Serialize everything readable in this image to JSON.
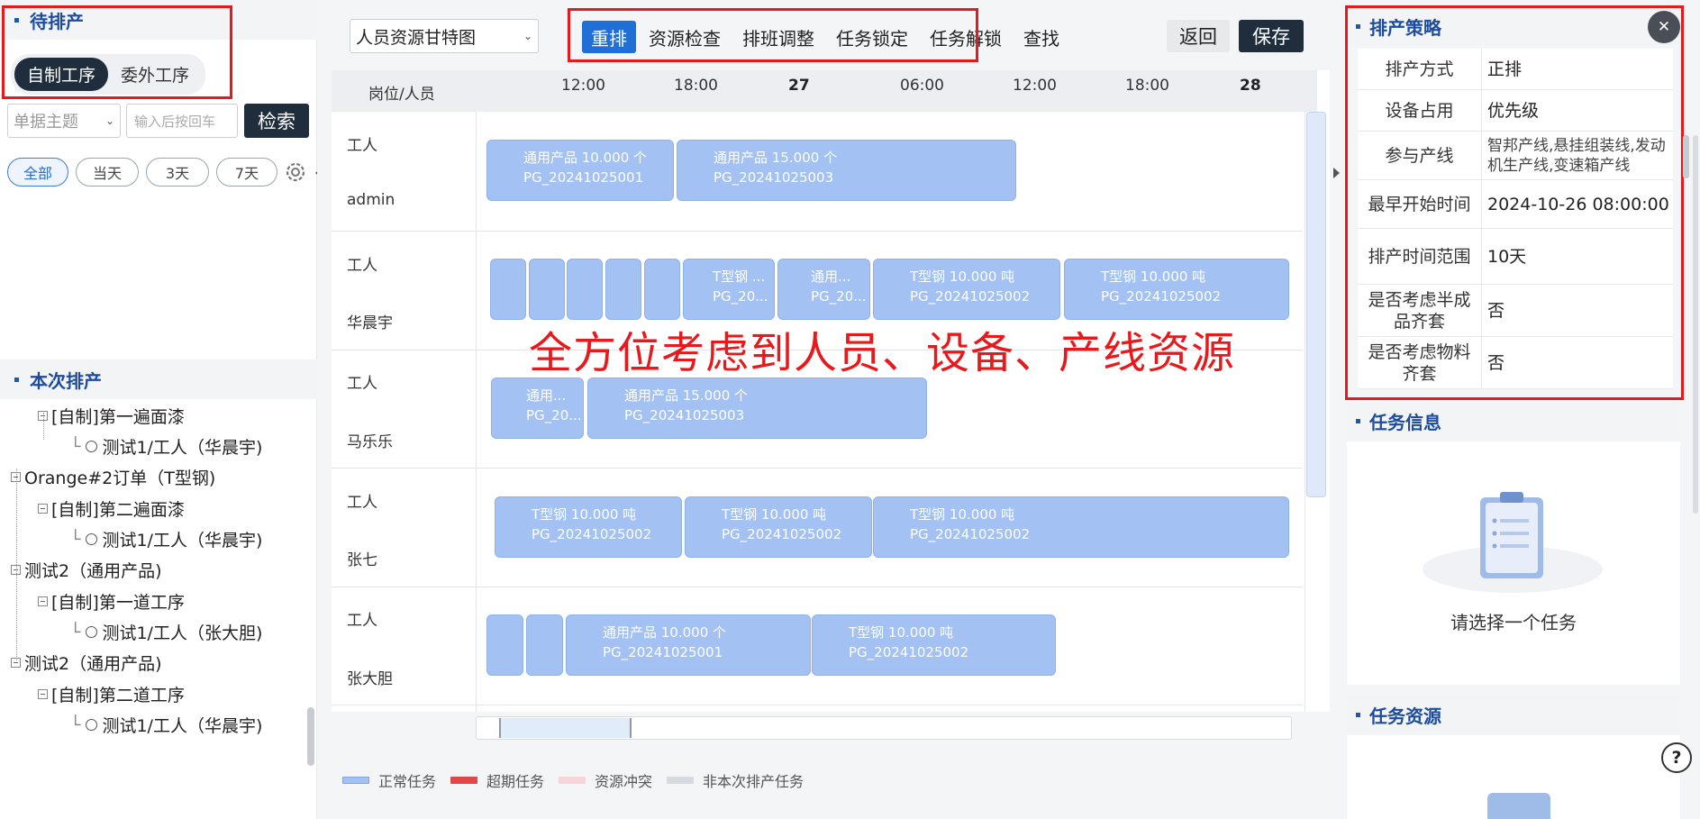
{
  "left": {
    "pending_title": "待排产",
    "tabs": [
      "自制工序",
      "委外工序"
    ],
    "doc_subject_placeholder": "单据主题",
    "search_placeholder": "输入后按回车",
    "search_button": "检索",
    "ranges": [
      "全部",
      "当天",
      "3天",
      "7天"
    ],
    "current_title": "本次排产",
    "tree": [
      "[自制]第一遍面漆",
      "测试1/工人（华晨宇)",
      "Orange#2订单（T型钢)",
      "[自制]第二遍面漆",
      "测试1/工人（华晨宇)",
      "测试2（通用产品)",
      "[自制]第一道工序",
      "测试1/工人（张大胆)",
      "测试2（通用产品)",
      "[自制]第二道工序",
      "测试1/工人（华晨宇)"
    ]
  },
  "center": {
    "view_select": "人员资源甘特图",
    "toolbar": [
      "重排",
      "资源检查",
      "排班调整",
      "任务锁定",
      "任务解锁",
      "查找"
    ],
    "back": "返回",
    "save": "保存",
    "header_label": "岗位/人员",
    "time_ticks": [
      "12:00",
      "18:00",
      "27",
      "06:00",
      "12:00",
      "18:00",
      "28"
    ],
    "rows": [
      {
        "role": "工人",
        "name": "admin"
      },
      {
        "role": "工人",
        "name": "华晨宇"
      },
      {
        "role": "工人",
        "name": "马乐乐"
      },
      {
        "role": "工人",
        "name": "张七"
      },
      {
        "role": "工人",
        "name": "张大胆"
      }
    ],
    "bars": [
      {
        "l1": "通用产品 10.000 个",
        "l2": "PG_20241025001"
      },
      {
        "l1": "通用产品 15.000 个",
        "l2": "PG_20241025003"
      },
      {
        "l1": "T型钢 ...",
        "l2": "PG_20..."
      },
      {
        "l1": "通用...",
        "l2": "PG_20..."
      },
      {
        "l1": "T型钢 10.000 吨",
        "l2": "PG_20241025002"
      },
      {
        "l1": "T型钢 10.000 吨",
        "l2": "PG_20241025002"
      },
      {
        "l1": "通用...",
        "l2": "PG_20..."
      },
      {
        "l1": "通用产品 15.000 个",
        "l2": "PG_20241025003"
      },
      {
        "l1": "T型钢 10.000 吨",
        "l2": "PG_20241025002"
      },
      {
        "l1": "T型钢 10.000 吨",
        "l2": "PG_20241025002"
      },
      {
        "l1": "T型钢 10.000 吨",
        "l2": "PG_20241025002"
      },
      {
        "l1": "通用产品 10.000 个",
        "l2": "PG_20241025001"
      },
      {
        "l1": "T型钢 10.000 吨",
        "l2": "PG_20241025002"
      }
    ],
    "overlay_text": "全方位考虑到人员、设备、产线资源",
    "legend": [
      {
        "label": "正常任务",
        "color": "#a3c2f3"
      },
      {
        "label": "超期任务",
        "color": "#e04848"
      },
      {
        "label": "资源冲突",
        "color": "#f8d4d6"
      },
      {
        "label": "非本次排产任务",
        "color": "#d5d9e0"
      }
    ]
  },
  "right": {
    "strategy_title": "排产策略",
    "strategy": [
      {
        "k": "排产方式",
        "v": "正排"
      },
      {
        "k": "设备占用",
        "v": "优先级"
      },
      {
        "k": "参与产线",
        "v": "智邦产线,悬挂组装线,发动机生产线,变速箱产线"
      },
      {
        "k": "最早开始时间",
        "v": "2024-10-26 08:00:00"
      },
      {
        "k": "排产时间范围",
        "v": "10天"
      },
      {
        "k": "是否考虑半成品齐套",
        "v": "否"
      },
      {
        "k": "是否考虑物料齐套",
        "v": "否"
      }
    ],
    "task_info_title": "任务信息",
    "empty_text": "请选择一个任务",
    "task_resource_title": "任务资源",
    "help": "?"
  }
}
